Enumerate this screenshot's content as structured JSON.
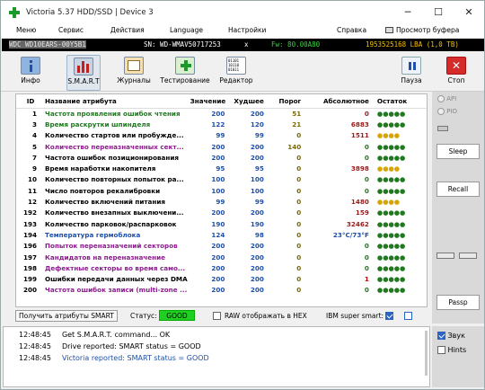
{
  "titlebar": {
    "title": "Victoria 5.37 HDD/SSD | Device 3",
    "min": "─",
    "max": "☐",
    "close": "✕"
  },
  "menu": {
    "items": [
      "Меню",
      "Сервис",
      "Действия",
      "Language",
      "Настройки",
      "Справка"
    ],
    "buffer": "Просмотр буфера"
  },
  "infobar": {
    "model": "WDC WD10EARS-00Y5B1",
    "serial": "SN: WD-WMAV50717253",
    "close": "x",
    "fw": "Fw: 80.00A80",
    "lba": "1953525168 LBA (1,0 TB)"
  },
  "toolbar": {
    "items": [
      "Инфо",
      "S.M.A.R.T",
      "Журналы",
      "Тестирование",
      "Редактор",
      "Пауза",
      "Стоп"
    ],
    "editor_icon_text": "01101\n10110\n01011"
  },
  "table": {
    "headers": [
      "ID",
      "Название атрибута",
      "Значение",
      "Худшее",
      "Порог",
      "Абсолютное",
      "Остаток"
    ],
    "rows": [
      {
        "id": "1",
        "name": "Частота проявления ошибок чтения",
        "value": "200",
        "worst": "200",
        "thresh": "51",
        "raw": "0",
        "rest": "●●●●●",
        "name_color": "#1f7a1f",
        "rest_color": "#1f7a1f",
        "raw_color": "#9b1b1b"
      },
      {
        "id": "3",
        "name": "Время раскрутки шпинделя",
        "value": "122",
        "worst": "120",
        "thresh": "21",
        "raw": "6883",
        "rest": "●●●●●",
        "name_color": "#1f7a1f",
        "rest_color": "#1f7a1f",
        "raw_color": "#9b1b1b"
      },
      {
        "id": "4",
        "name": "Количество стартов или пробужде...",
        "value": "99",
        "worst": "99",
        "thresh": "0",
        "raw": "1511",
        "rest": "●●●●",
        "name_color": "#000000",
        "rest_color": "#d8a400",
        "raw_color": "#9b1b1b"
      },
      {
        "id": "5",
        "name": "Количество переназначенных сект...",
        "value": "200",
        "worst": "200",
        "thresh": "140",
        "raw": "0",
        "rest": "●●●●●",
        "name_color": "#8b1c8b",
        "rest_color": "#1f7a1f",
        "raw_color": "#1f7a1f"
      },
      {
        "id": "7",
        "name": "Частота ошибок позиционирования",
        "value": "200",
        "worst": "200",
        "thresh": "0",
        "raw": "0",
        "rest": "●●●●●",
        "name_color": "#000000",
        "rest_color": "#1f7a1f",
        "raw_color": "#1f7a1f"
      },
      {
        "id": "9",
        "name": "Время наработки накопителя",
        "value": "95",
        "worst": "95",
        "thresh": "0",
        "raw": "3898",
        "rest": "●●●●",
        "name_color": "#000000",
        "rest_color": "#d8a400",
        "raw_color": "#9b1b1b"
      },
      {
        "id": "10",
        "name": "Количество повторных попыток ра...",
        "value": "100",
        "worst": "100",
        "thresh": "0",
        "raw": "0",
        "rest": "●●●●●",
        "name_color": "#000000",
        "rest_color": "#1f7a1f",
        "raw_color": "#1f7a1f"
      },
      {
        "id": "11",
        "name": "Число повторов рекалибровки",
        "value": "100",
        "worst": "100",
        "thresh": "0",
        "raw": "0",
        "rest": "●●●●●",
        "name_color": "#000000",
        "rest_color": "#1f7a1f",
        "raw_color": "#1f7a1f"
      },
      {
        "id": "12",
        "name": "Количество включений питания",
        "value": "99",
        "worst": "99",
        "thresh": "0",
        "raw": "1480",
        "rest": "●●●●",
        "name_color": "#000000",
        "rest_color": "#d8a400",
        "raw_color": "#9b1b1b"
      },
      {
        "id": "192",
        "name": "Количество внезапных выключени...",
        "value": "200",
        "worst": "200",
        "thresh": "0",
        "raw": "159",
        "rest": "●●●●●",
        "name_color": "#000000",
        "rest_color": "#1f7a1f",
        "raw_color": "#9b1b1b"
      },
      {
        "id": "193",
        "name": "Количество парковок/распарковок",
        "value": "190",
        "worst": "190",
        "thresh": "0",
        "raw": "32462",
        "rest": "●●●●●",
        "name_color": "#000000",
        "rest_color": "#1f7a1f",
        "raw_color": "#9b1b1b"
      },
      {
        "id": "194",
        "name": "Температура гермоблока",
        "value": "124",
        "worst": "98",
        "thresh": "0",
        "raw": "23°C/73°F",
        "rest": "●●●●●",
        "name_color": "#1f4fa8",
        "rest_color": "#1f7a1f",
        "raw_color": "#1f4fa8"
      },
      {
        "id": "196",
        "name": "Попыток переназначений секторов",
        "value": "200",
        "worst": "200",
        "thresh": "0",
        "raw": "0",
        "rest": "●●●●●",
        "name_color": "#8b1c8b",
        "rest_color": "#1f7a1f",
        "raw_color": "#1f7a1f"
      },
      {
        "id": "197",
        "name": "Кандидатов на переназначение",
        "value": "200",
        "worst": "200",
        "thresh": "0",
        "raw": "0",
        "rest": "●●●●●",
        "name_color": "#8b1c8b",
        "rest_color": "#1f7a1f",
        "raw_color": "#1f7a1f"
      },
      {
        "id": "198",
        "name": "Дефектные секторы во время само...",
        "value": "200",
        "worst": "200",
        "thresh": "0",
        "raw": "0",
        "rest": "●●●●●",
        "name_color": "#8b1c8b",
        "rest_color": "#1f7a1f",
        "raw_color": "#1f7a1f"
      },
      {
        "id": "199",
        "name": "Ошибки передачи данных через DMA",
        "value": "200",
        "worst": "200",
        "thresh": "0",
        "raw": "1",
        "rest": "●●●●●",
        "name_color": "#000000",
        "rest_color": "#1f7a1f",
        "raw_color": "#cc0000"
      },
      {
        "id": "200",
        "name": "Частота ошибок записи (multi-zone ...",
        "value": "200",
        "worst": "200",
        "thresh": "0",
        "raw": "0",
        "rest": "●●●●●",
        "name_color": "#8b1c8b",
        "rest_color": "#1f7a1f",
        "raw_color": "#1f7a1f"
      }
    ]
  },
  "status": {
    "get_button": "Получить атрибуты SMART",
    "status_label": "Статус:",
    "status_value": "GOOD",
    "raw_hex_label": "RAW отображать в HEX",
    "ibm_label": "IBM super smart:"
  },
  "log": [
    {
      "time": "12:48:45",
      "text": "Get S.M.A.R.T. command... OK",
      "color": "#000000"
    },
    {
      "time": "12:48:45",
      "text": "Drive reported: SMART status = GOOD",
      "color": "#000000"
    },
    {
      "time": "12:48:45",
      "text": "Victoria reported: SMART status = GOOD",
      "color": "#1f4fa8"
    }
  ],
  "side": {
    "api": "API",
    "pio": "PIO",
    "sleep": "Sleep",
    "recall": "Recall",
    "passp": "Passp",
    "sound": "Звук",
    "hints": "Hints"
  }
}
